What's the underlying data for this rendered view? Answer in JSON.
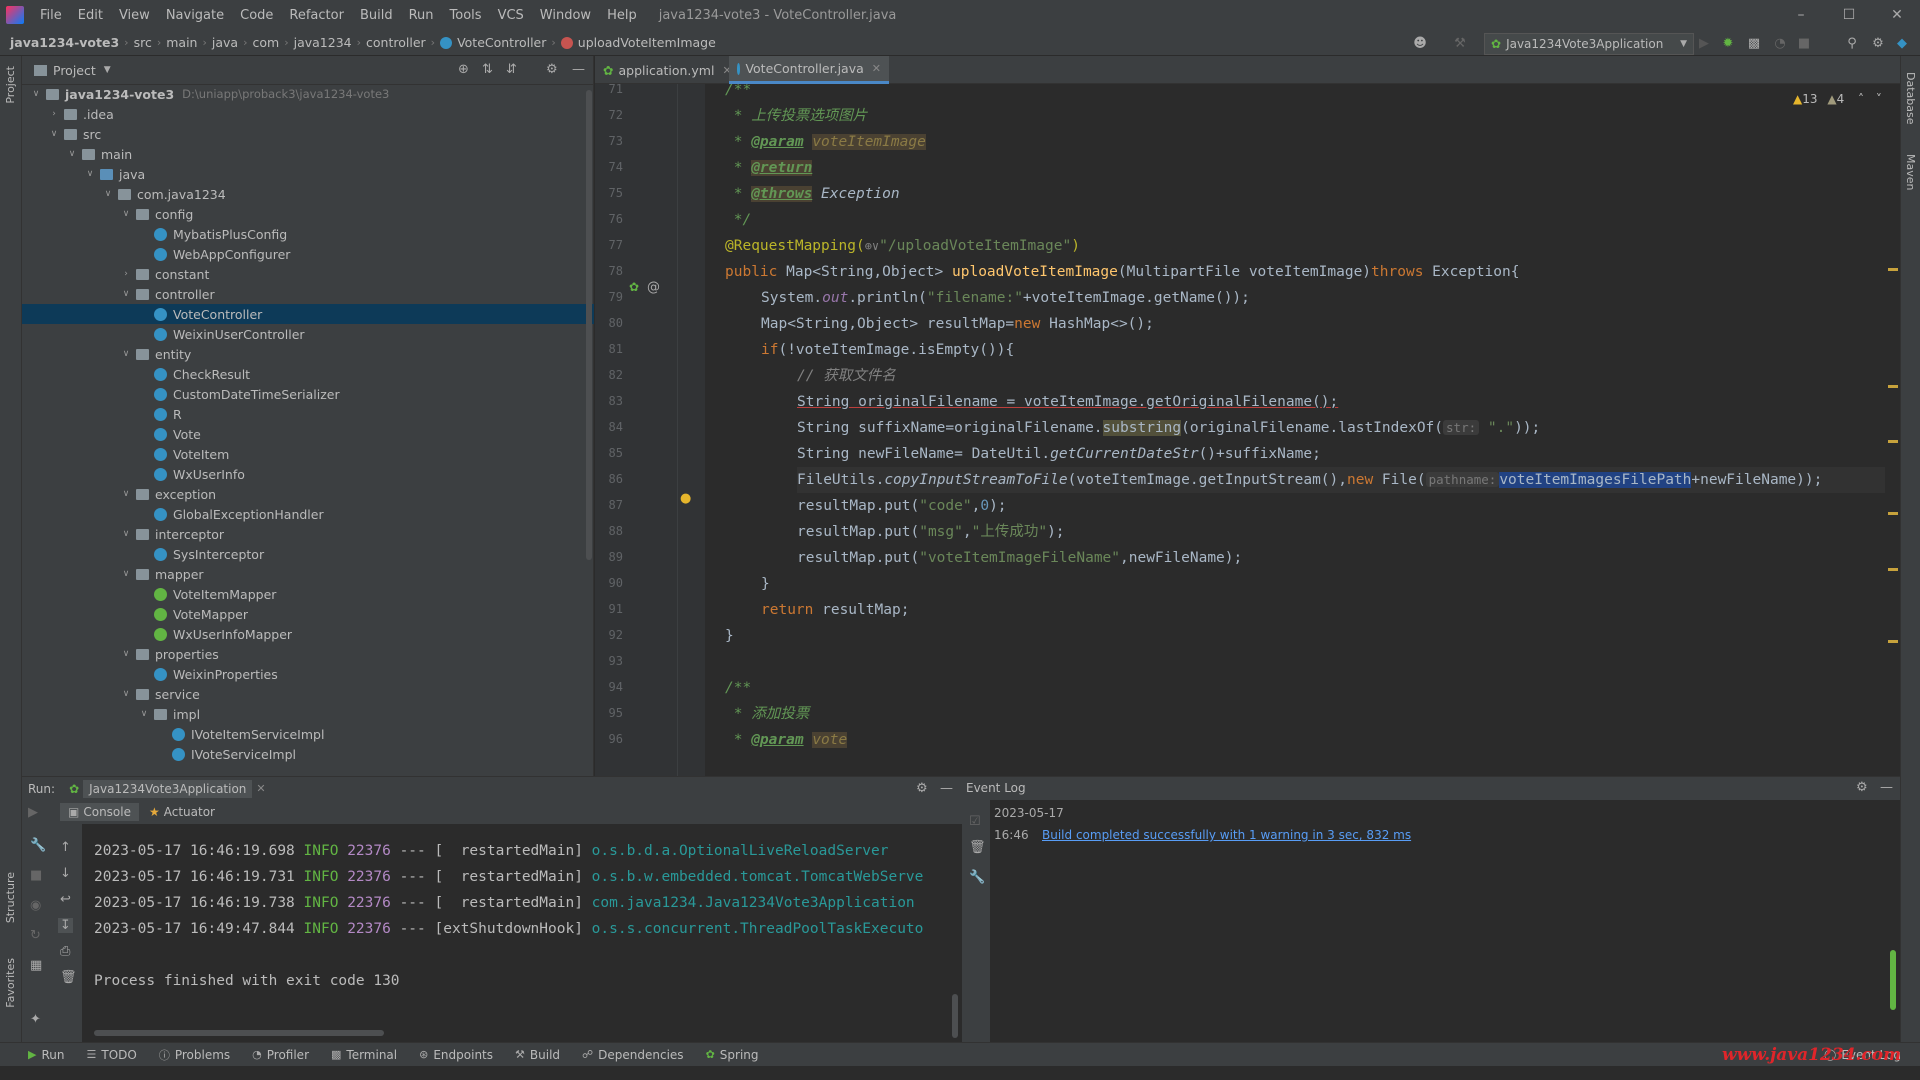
{
  "menubar": {
    "items": [
      "File",
      "Edit",
      "View",
      "Navigate",
      "Code",
      "Refactor",
      "Build",
      "Run",
      "Tools",
      "VCS",
      "Window",
      "Help"
    ],
    "window_title": "java1234-vote3 - VoteController.java"
  },
  "navbar": {
    "crumbs": [
      "java1234-vote3",
      "src",
      "main",
      "java",
      "com",
      "java1234",
      "controller",
      "VoteController",
      "uploadVoteItemImage"
    ],
    "run_config": "Java1234Vote3Application"
  },
  "project": {
    "header": "Project",
    "root_path": "D:\\uniapp\\proback3\\java1234-vote3",
    "tree": [
      {
        "label": "java1234-vote3",
        "type": "module",
        "depth": 0,
        "open": true
      },
      {
        "label": ".idea",
        "type": "folder",
        "depth": 1,
        "open": false
      },
      {
        "label": "src",
        "type": "folder",
        "depth": 1,
        "open": true
      },
      {
        "label": "main",
        "type": "folder",
        "depth": 2,
        "open": true
      },
      {
        "label": "java",
        "type": "srcfolder",
        "depth": 3,
        "open": true
      },
      {
        "label": "com.java1234",
        "type": "folder",
        "depth": 4,
        "open": true
      },
      {
        "label": "config",
        "type": "folder",
        "depth": 5,
        "open": true
      },
      {
        "label": "MybatisPlusConfig",
        "type": "class",
        "depth": 6
      },
      {
        "label": "WebAppConfigurer",
        "type": "class",
        "depth": 6
      },
      {
        "label": "constant",
        "type": "folder",
        "depth": 5,
        "open": false
      },
      {
        "label": "controller",
        "type": "folder",
        "depth": 5,
        "open": true
      },
      {
        "label": "VoteController",
        "type": "class",
        "depth": 6,
        "selected": true
      },
      {
        "label": "WeixinUserController",
        "type": "class",
        "depth": 6
      },
      {
        "label": "entity",
        "type": "folder",
        "depth": 5,
        "open": true
      },
      {
        "label": "CheckResult",
        "type": "class",
        "depth": 6
      },
      {
        "label": "CustomDateTimeSerializer",
        "type": "class",
        "depth": 6
      },
      {
        "label": "R",
        "type": "class",
        "depth": 6
      },
      {
        "label": "Vote",
        "type": "class",
        "depth": 6
      },
      {
        "label": "VoteItem",
        "type": "class",
        "depth": 6
      },
      {
        "label": "WxUserInfo",
        "type": "class",
        "depth": 6
      },
      {
        "label": "exception",
        "type": "folder",
        "depth": 5,
        "open": true
      },
      {
        "label": "GlobalExceptionHandler",
        "type": "class",
        "depth": 6
      },
      {
        "label": "interceptor",
        "type": "folder",
        "depth": 5,
        "open": true
      },
      {
        "label": "SysInterceptor",
        "type": "class",
        "depth": 6
      },
      {
        "label": "mapper",
        "type": "folder",
        "depth": 5,
        "open": true
      },
      {
        "label": "VoteItemMapper",
        "type": "interface",
        "depth": 6
      },
      {
        "label": "VoteMapper",
        "type": "interface",
        "depth": 6
      },
      {
        "label": "WxUserInfoMapper",
        "type": "interface",
        "depth": 6
      },
      {
        "label": "properties",
        "type": "folder",
        "depth": 5,
        "open": true
      },
      {
        "label": "WeixinProperties",
        "type": "class",
        "depth": 6
      },
      {
        "label": "service",
        "type": "folder",
        "depth": 5,
        "open": true
      },
      {
        "label": "impl",
        "type": "folder",
        "depth": 6,
        "open": true
      },
      {
        "label": "IVoteItemServiceImpl",
        "type": "class",
        "depth": 7
      },
      {
        "label": "IVoteServiceImpl",
        "type": "class",
        "depth": 7
      }
    ]
  },
  "editor": {
    "tabs": [
      {
        "label": "application.yml",
        "active": false
      },
      {
        "label": "VoteController.java",
        "active": true
      }
    ],
    "inspections": {
      "warnings": "13",
      "weak_warnings": "4"
    },
    "line_numbers": [
      "71",
      "72",
      "73",
      "74",
      "75",
      "76",
      "77",
      "78",
      "79",
      "80",
      "81",
      "82",
      "83",
      "84",
      "85",
      "86",
      "87",
      "88",
      "89",
      "90",
      "91",
      "92",
      "93",
      "94",
      "95",
      "96"
    ],
    "code": {
      "l71": "/**",
      "l72_star": " * ",
      "l72_text": "上传投票选项图片",
      "l73_star": " * ",
      "l73_tag": "@param",
      "l73_name": "voteItemImage",
      "l74_star": " * ",
      "l74_tag": "@return",
      "l75_star": " * ",
      "l75_tag": "@throws",
      "l75_text": " Exception",
      "l76": " */",
      "l77_ann": "@RequestMapping(",
      "l77_icon": "⊕∨",
      "l77_str": "\"/uploadVoteItemImage\"",
      "l77_end": ")",
      "l78_kw": "public",
      "l78_a": " Map<String,Object> ",
      "l78_fn": "uploadVoteItemImage",
      "l78_b": "(MultipartFile voteItemImage)",
      "l78_kw2": "throws",
      "l78_c": " Exception{",
      "l79_a": "System.",
      "l79_out": "out",
      "l79_b": ".println(",
      "l79_str": "\"filename:\"",
      "l79_c": "+voteItemImage.getName());",
      "l80_a": "Map<String,Object> resultMap=",
      "l80_kw": "new",
      "l80_b": " HashMap<>();",
      "l81_kw": "if",
      "l81_a": "(!voteItemImage.isEmpty()){",
      "l82": "// 获取文件名",
      "l83": "String originalFilename = voteItemImage.getOriginalFilename();",
      "l84_a": "String suffixName=originalFilename.",
      "l84_hl": "substring",
      "l84_b": "(originalFilename.lastIndexOf(",
      "l84_hint": "str:",
      "l84_str": " \".\"",
      "l84_c": "));",
      "l85_a": "String newFileName= DateUtil.",
      "l85_it": "getCurrentDateStr",
      "l85_b": "()+suffixName;",
      "l86_a": "FileUtils.",
      "l86_it": "copyInputStreamToFile",
      "l86_b": "(voteItemImage.getInputStream(),",
      "l86_kw": "new",
      "l86_c": " File(",
      "l86_hint": "pathname:",
      "l86_sel": "voteItemImagesFilePath",
      "l86_d": "+newFileName));",
      "l87_a": "resultMap.put(",
      "l87_s1": "\"code\"",
      "l87_b": ",",
      "l87_n": "0",
      "l87_c": ");",
      "l88_a": "resultMap.put(",
      "l88_s1": "\"msg\"",
      "l88_b": ",",
      "l88_s2": "\"上传成功\"",
      "l88_c": ");",
      "l89_a": "resultMap.put(",
      "l89_s1": "\"voteItemImageFileName\"",
      "l89_b": ",newFileName);",
      "l90": "}",
      "l91_kw": "return",
      "l91_a": " resultMap;",
      "l92": "}",
      "l94": "/**",
      "l95_star": " * ",
      "l95_text": "添加投票",
      "l96_star": " * ",
      "l96_tag": "@param",
      "l96_name": "vote"
    }
  },
  "run": {
    "label": "Run:",
    "config": "Java1234Vote3Application",
    "tabs": [
      "Console",
      "Actuator"
    ],
    "logs": [
      {
        "ts": "2023-05-17 16:46:19.698",
        "level": "INFO",
        "pid": "22376",
        "sep": "---",
        "thread": "[  restartedMain]",
        "cls": "o.s.b.d.a.OptionalLiveReloadServer"
      },
      {
        "ts": "2023-05-17 16:46:19.731",
        "level": "INFO",
        "pid": "22376",
        "sep": "---",
        "thread": "[  restartedMain]",
        "cls": "o.s.b.w.embedded.tomcat.TomcatWebServe"
      },
      {
        "ts": "2023-05-17 16:46:19.738",
        "level": "INFO",
        "pid": "22376",
        "sep": "---",
        "thread": "[  restartedMain]",
        "cls": "com.java1234.Java1234Vote3Application"
      },
      {
        "ts": "2023-05-17 16:49:47.844",
        "level": "INFO",
        "pid": "22376",
        "sep": "---",
        "thread": "[extShutdownHook]",
        "cls": "o.s.s.concurrent.ThreadPoolTaskExecuto"
      }
    ],
    "exit_message": "Process finished with exit code 130"
  },
  "event_log": {
    "title": "Event Log",
    "date": "2023-05-17",
    "time": "16:46",
    "message": "Build completed successfully with 1 warning in 3 sec, 832 ms"
  },
  "bottombar": {
    "items": [
      "Run",
      "TODO",
      "Problems",
      "Profiler",
      "Terminal",
      "Endpoints",
      "Build",
      "Dependencies",
      "Spring"
    ],
    "event_log": "Event Log"
  },
  "side_labels": {
    "project": "Project",
    "structure": "Structure",
    "favorites": "Favorites",
    "database": "Database",
    "maven": "Maven"
  },
  "watermark": "www.java1234.com"
}
